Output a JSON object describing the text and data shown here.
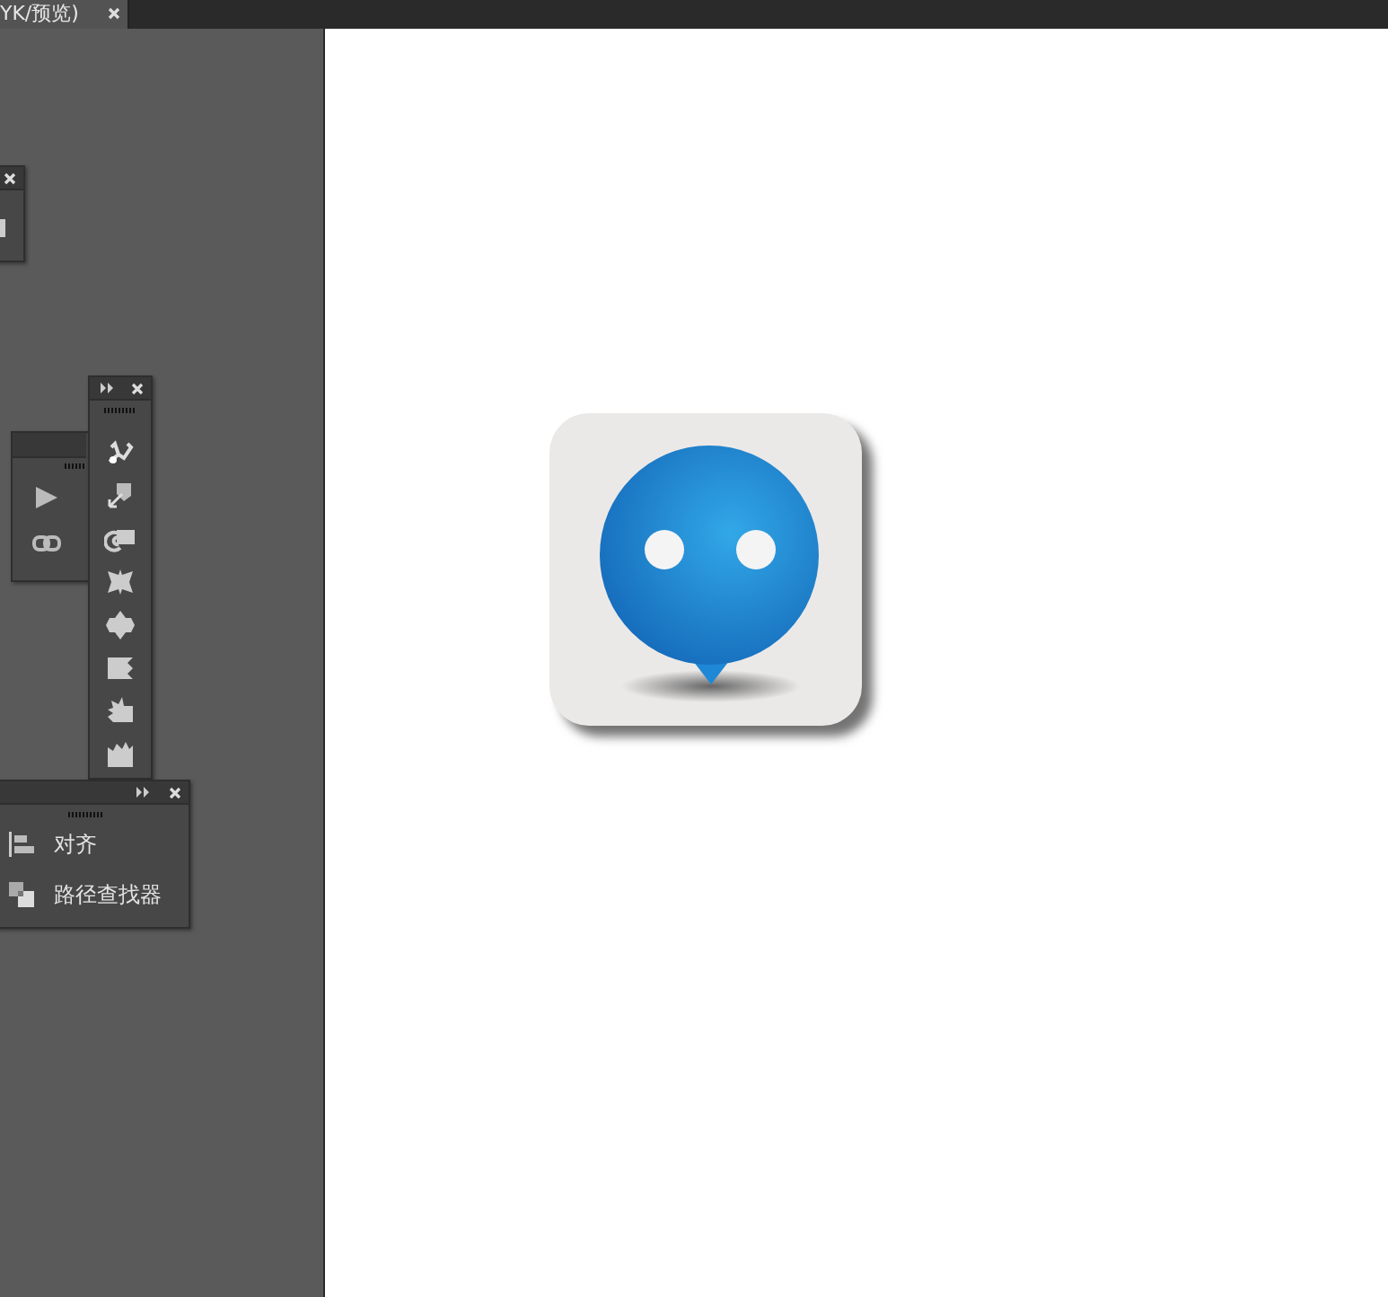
{
  "document_tab": {
    "title": "YK/预览)"
  },
  "align_panel": {
    "items": [
      {
        "label": "对齐",
        "kind": "align"
      },
      {
        "label": "路径查找器",
        "kind": "pathfinder"
      }
    ]
  }
}
